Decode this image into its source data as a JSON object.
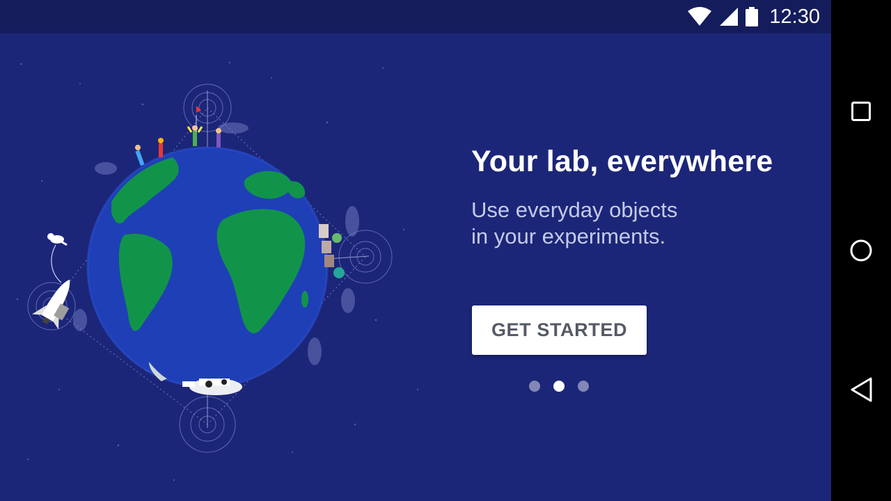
{
  "status_bar": {
    "time": "12:30",
    "icons": [
      "wifi-icon",
      "cell-signal-icon",
      "battery-icon"
    ]
  },
  "onboarding": {
    "title": "Your lab, everywhere",
    "subtitle_line1": "Use everyday objects",
    "subtitle_line2": "in your experiments.",
    "cta_label": "GET STARTED",
    "page_indicator": {
      "total": 3,
      "current": 2
    }
  },
  "nav_bar": {
    "buttons": [
      "recents-square-icon",
      "home-circle-icon",
      "back-triangle-icon"
    ]
  },
  "colors": {
    "background": "#1c2678",
    "status_bar": "#141c5c",
    "land": "#11944a",
    "ocean": "#1f3fb6",
    "button": "#ffffff"
  }
}
